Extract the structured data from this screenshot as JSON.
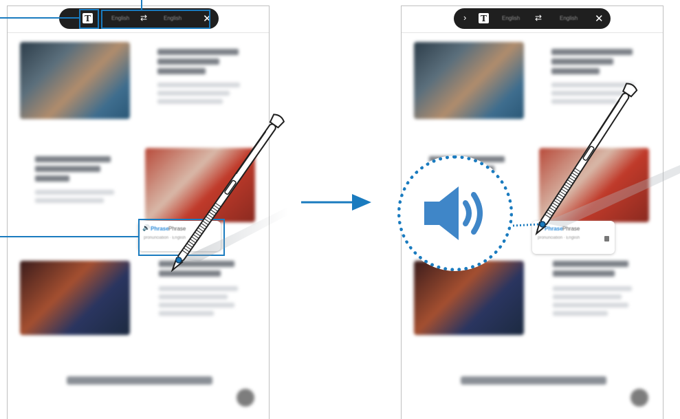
{
  "left_panel": {
    "toolbar": {
      "text_mode_icon": "T",
      "source_language": "English",
      "swap_icon": "⇄",
      "target_language": "English",
      "close_icon": "✕"
    },
    "popup": {
      "speaker_icon": "🔊",
      "word": "Phrase",
      "translation": "Phrase",
      "detail": "pronunciation · English"
    }
  },
  "right_panel": {
    "toolbar": {
      "expand_icon": "›",
      "text_mode_icon": "T",
      "source_language": "English",
      "swap_icon": "⇄",
      "target_language": "English",
      "close_icon": "✕"
    },
    "popup": {
      "speaker_icon": "🔊",
      "word": "Phrase",
      "translation": "Phrase",
      "detail": "pronunciation · English"
    },
    "zoom": {
      "icon": "speaker-icon"
    }
  },
  "colors": {
    "accent": "#1a7bbf",
    "speaker_blue": "#3f86c8",
    "toolbar_bg": "#1f1f1f"
  }
}
